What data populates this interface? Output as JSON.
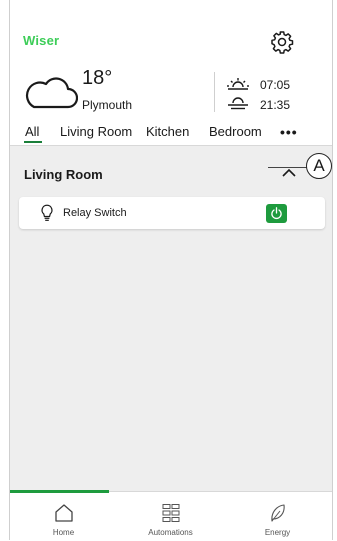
{
  "header": {
    "logo": "Wiser",
    "weather": {
      "temperature": "18°",
      "city": "Plymouth",
      "sunrise": "07:05",
      "sunset": "21:35"
    },
    "tabs": [
      "All",
      "Living Room",
      "Kitchen",
      "Bedroom"
    ],
    "more": "•••"
  },
  "section": {
    "title": "Living Room"
  },
  "device": {
    "name": "Relay Switch"
  },
  "callout": "A",
  "bottom_nav": [
    {
      "label": "Home"
    },
    {
      "label": "Automations"
    },
    {
      "label": "Energy"
    }
  ],
  "colors": {
    "accent": "#1e9b3e",
    "logo": "#3dcd58",
    "background": "#eeeeee"
  }
}
